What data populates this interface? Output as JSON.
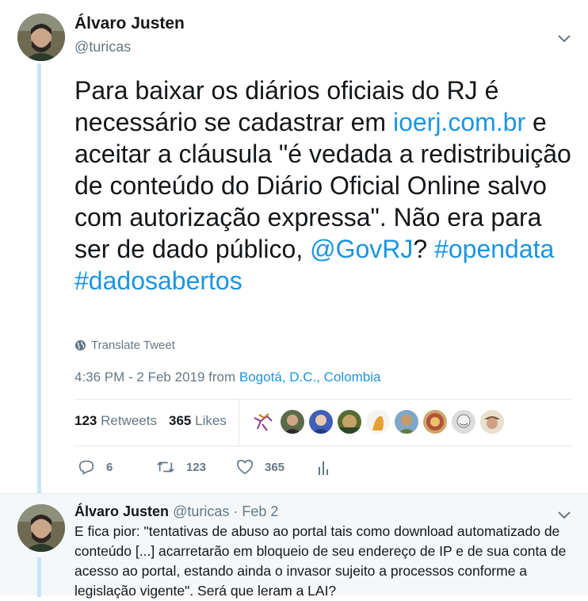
{
  "main_tweet": {
    "author_name": "Álvaro Justen",
    "author_handle": "@turicas",
    "text_parts": {
      "t1": "Para baixar os diários oficiais do RJ é necessário se cadastrar em ",
      "link": "ioerj.com.br",
      "t2": " e aceitar a cláusula \"é vedada a redistribuição de conteúdo do Diário Oficial Online salvo com autorização expressa\". Não era para ser de dado público, ",
      "mention": "@GovRJ",
      "t3": "? ",
      "hashtag1": "#opendata",
      "t4": " ",
      "hashtag2": "#dadosabertos"
    },
    "translate_label": "Translate Tweet",
    "timestamp": "4:36 PM - 2 Feb 2019 from ",
    "location": "Bogotá, D.C., Colombia",
    "retweet_count": "123",
    "retweet_label": "Retweets",
    "like_count": "365",
    "like_label": "Likes",
    "actions": {
      "reply_count": "6",
      "retweet_count": "123",
      "like_count": "365"
    }
  },
  "reply_tweet": {
    "author_name": "Álvaro Justen",
    "author_handle": "@turicas",
    "separator": "·",
    "date": "Feb 2",
    "text": "E fica pior: \"tentativas de abuso ao portal tais como download automatizado de conteúdo [...] acarretarão em bloqueio de seu endereço de IP e de sua conta de acesso ao portal, estando ainda o invasor sujeito a processos conforme a legislação vigente\". Será que leram a LAI?"
  },
  "colors": {
    "link": "#1b95e0",
    "secondary_text": "#657786",
    "thread_line": "#c6e6f8"
  },
  "icons": [
    "globe-icon",
    "chevron-down-icon",
    "reply-icon",
    "retweet-icon",
    "heart-icon",
    "analytics-icon"
  ]
}
